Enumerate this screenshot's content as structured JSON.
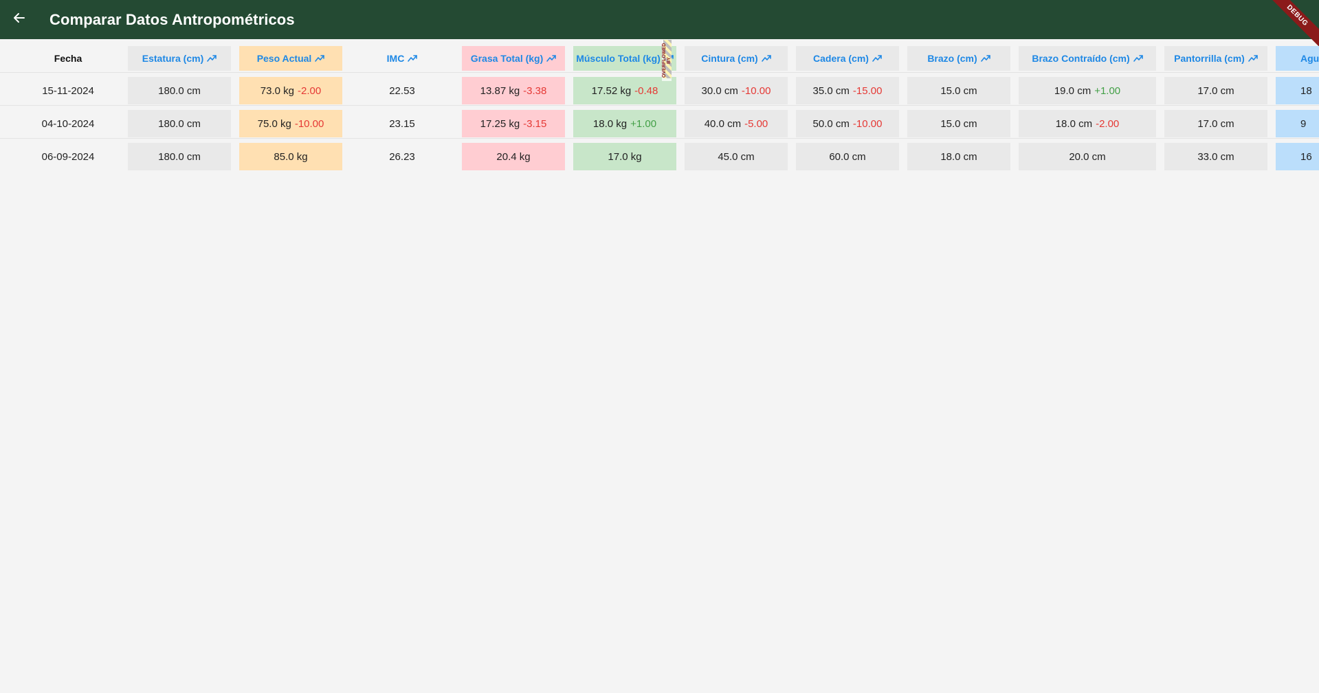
{
  "appbar": {
    "title": "Comparar Datos Antropométricos",
    "back_icon": "arrow-back-icon",
    "debug_banner": "DEBUG",
    "background": "#244a33"
  },
  "overflow_indicator": "OVERFLOWED BY",
  "colors": {
    "header_link": "#1e88e5",
    "delta_negative": "#e53935",
    "delta_positive": "#43a047",
    "peso_bg": "#ffe0b2",
    "grasa_bg": "#ffcdd2",
    "musculo_bg": "#c8e6c9",
    "agua_bg": "#bbdefb",
    "neutral_bg": "#e9e9e9"
  },
  "table": {
    "headers": [
      {
        "label": "Fecha",
        "trend": false
      },
      {
        "label": "Estatura (cm)",
        "trend": true
      },
      {
        "label": "Peso Actual",
        "trend": true
      },
      {
        "label": "IMC",
        "trend": true
      },
      {
        "label": "Grasa Total (kg)",
        "trend": true
      },
      {
        "label": "Músculo Total (kg)",
        "trend": true
      },
      {
        "label": "Cintura (cm)",
        "trend": true
      },
      {
        "label": "Cadera (cm)",
        "trend": true
      },
      {
        "label": "Brazo (cm)",
        "trend": true
      },
      {
        "label": "Brazo Contraído (cm)",
        "trend": true
      },
      {
        "label": "Pantorrilla (cm)",
        "trend": true
      },
      {
        "label": "Agu",
        "trend": false
      }
    ],
    "rows": [
      {
        "cells": [
          {
            "value": "15-11-2024",
            "delta": ""
          },
          {
            "value": "180.0 cm",
            "delta": ""
          },
          {
            "value": "73.0 kg",
            "delta": "-2.00"
          },
          {
            "value": "22.53",
            "delta": ""
          },
          {
            "value": "13.87 kg",
            "delta": "-3.38"
          },
          {
            "value": "17.52 kg",
            "delta": "-0.48"
          },
          {
            "value": "30.0 cm",
            "delta": "-10.00"
          },
          {
            "value": "35.0 cm",
            "delta": "-15.00"
          },
          {
            "value": "15.0 cm",
            "delta": ""
          },
          {
            "value": "19.0 cm",
            "delta": "+1.00"
          },
          {
            "value": "17.0 cm",
            "delta": ""
          },
          {
            "value": "18",
            "delta": ""
          }
        ]
      },
      {
        "cells": [
          {
            "value": "04-10-2024",
            "delta": ""
          },
          {
            "value": "180.0 cm",
            "delta": ""
          },
          {
            "value": "75.0 kg",
            "delta": "-10.00"
          },
          {
            "value": "23.15",
            "delta": ""
          },
          {
            "value": "17.25 kg",
            "delta": "-3.15"
          },
          {
            "value": "18.0 kg",
            "delta": "+1.00"
          },
          {
            "value": "40.0 cm",
            "delta": "-5.00"
          },
          {
            "value": "50.0 cm",
            "delta": "-10.00"
          },
          {
            "value": "15.0 cm",
            "delta": ""
          },
          {
            "value": "18.0 cm",
            "delta": "-2.00"
          },
          {
            "value": "17.0 cm",
            "delta": ""
          },
          {
            "value": "9",
            "delta": ""
          }
        ]
      },
      {
        "cells": [
          {
            "value": "06-09-2024",
            "delta": ""
          },
          {
            "value": "180.0 cm",
            "delta": ""
          },
          {
            "value": "85.0 kg",
            "delta": ""
          },
          {
            "value": "26.23",
            "delta": ""
          },
          {
            "value": "20.4 kg",
            "delta": ""
          },
          {
            "value": "17.0 kg",
            "delta": ""
          },
          {
            "value": "45.0 cm",
            "delta": ""
          },
          {
            "value": "60.0 cm",
            "delta": ""
          },
          {
            "value": "18.0 cm",
            "delta": ""
          },
          {
            "value": "20.0 cm",
            "delta": ""
          },
          {
            "value": "33.0 cm",
            "delta": ""
          },
          {
            "value": "16",
            "delta": ""
          }
        ]
      }
    ]
  }
}
